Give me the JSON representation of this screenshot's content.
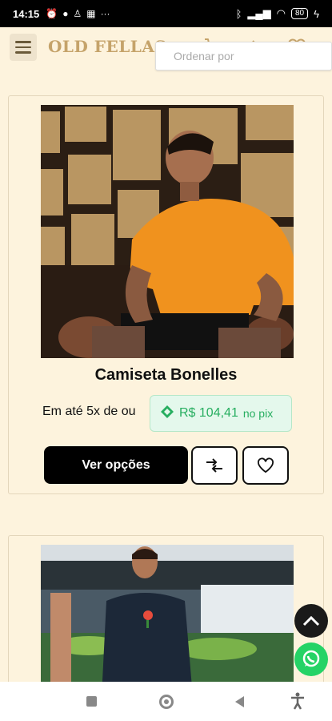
{
  "status_bar": {
    "time": "14:15",
    "battery": "80"
  },
  "header": {
    "logo": "OLD FELLAS",
    "sort_placeholder": "Ordenar por"
  },
  "products": [
    {
      "name": "Camiseta Bonelles",
      "installment_text": "Em até 5x de ou",
      "pix_price": "R$ 104,41",
      "pix_label": "no pix",
      "options_button": "Ver opções"
    }
  ],
  "colors": {
    "background": "#fdf3dd",
    "brand": "#c5a36a",
    "pix_green": "#27ae60",
    "whatsapp": "#25d366"
  },
  "icons": [
    "menu-icon",
    "cart-icon",
    "compare-icon",
    "heart-icon",
    "pix-icon",
    "chevron-up-icon",
    "whatsapp-icon"
  ]
}
